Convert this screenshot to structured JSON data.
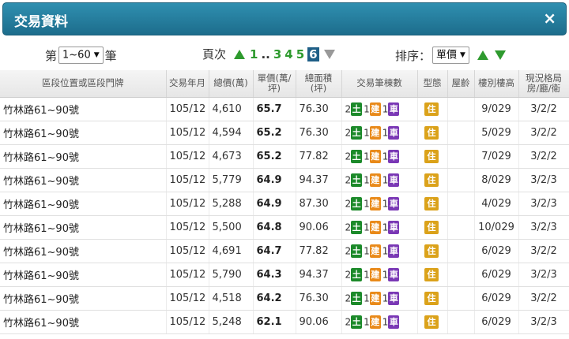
{
  "window": {
    "title": "交易資料",
    "close_glyph": "×"
  },
  "controls": {
    "count_prefix": "第",
    "count_value": "1~60",
    "count_suffix": "筆",
    "pages_label": "頁次",
    "page_first": "1",
    "page_ellipsis": "..",
    "pages": [
      "3",
      "4",
      "5"
    ],
    "page_current": "6",
    "sort_label": "排序：",
    "sort_value": "單價"
  },
  "table": {
    "headers": {
      "location": "區段位置或區段門牌",
      "year_month": "交易年月",
      "total_price": "總價(萬)",
      "unit_price": "單價(萬/坪)",
      "area": "總面積(坪)",
      "units": "交易筆棟數",
      "type": "型態",
      "age": "屋齡",
      "floor": "樓別樓高",
      "layout": "現況格局房/廳/衛"
    },
    "badge_labels": {
      "land": "土",
      "building": "建",
      "parking": "車",
      "type": "住"
    },
    "rows": [
      {
        "location": "竹林路61~90號",
        "ym": "105/12",
        "total": "4,610",
        "unit": "65.7",
        "area": "76.30",
        "land": "2",
        "bldg": "1",
        "park": "1",
        "type": "住",
        "age": "",
        "floor": "9/029",
        "layout": "3/2/2"
      },
      {
        "location": "竹林路61~90號",
        "ym": "105/12",
        "total": "4,594",
        "unit": "65.2",
        "area": "76.30",
        "land": "2",
        "bldg": "1",
        "park": "1",
        "type": "住",
        "age": "",
        "floor": "5/029",
        "layout": "3/2/2"
      },
      {
        "location": "竹林路61~90號",
        "ym": "105/12",
        "total": "4,673",
        "unit": "65.2",
        "area": "77.82",
        "land": "2",
        "bldg": "1",
        "park": "1",
        "type": "住",
        "age": "",
        "floor": "7/029",
        "layout": "3/2/2"
      },
      {
        "location": "竹林路61~90號",
        "ym": "105/12",
        "total": "5,779",
        "unit": "64.9",
        "area": "94.37",
        "land": "2",
        "bldg": "1",
        "park": "1",
        "type": "住",
        "age": "",
        "floor": "8/029",
        "layout": "3/2/3"
      },
      {
        "location": "竹林路61~90號",
        "ym": "105/12",
        "total": "5,288",
        "unit": "64.9",
        "area": "87.30",
        "land": "2",
        "bldg": "1",
        "park": "1",
        "type": "住",
        "age": "",
        "floor": "4/029",
        "layout": "3/2/3"
      },
      {
        "location": "竹林路61~90號",
        "ym": "105/12",
        "total": "5,500",
        "unit": "64.8",
        "area": "90.06",
        "land": "2",
        "bldg": "1",
        "park": "1",
        "type": "住",
        "age": "",
        "floor": "10/029",
        "layout": "3/2/3"
      },
      {
        "location": "竹林路61~90號",
        "ym": "105/12",
        "total": "4,691",
        "unit": "64.7",
        "area": "77.82",
        "land": "2",
        "bldg": "1",
        "park": "1",
        "type": "住",
        "age": "",
        "floor": "6/029",
        "layout": "3/2/2"
      },
      {
        "location": "竹林路61~90號",
        "ym": "105/12",
        "total": "5,790",
        "unit": "64.3",
        "area": "94.37",
        "land": "2",
        "bldg": "1",
        "park": "1",
        "type": "住",
        "age": "",
        "floor": "6/029",
        "layout": "3/2/3"
      },
      {
        "location": "竹林路61~90號",
        "ym": "105/12",
        "total": "4,518",
        "unit": "64.2",
        "area": "76.30",
        "land": "2",
        "bldg": "1",
        "park": "1",
        "type": "住",
        "age": "",
        "floor": "6/029",
        "layout": "3/2/2"
      },
      {
        "location": "竹林路61~90號",
        "ym": "105/12",
        "total": "5,248",
        "unit": "62.1",
        "area": "90.06",
        "land": "2",
        "bldg": "1",
        "park": "1",
        "type": "住",
        "age": "",
        "floor": "6/029",
        "layout": "3/2/3"
      }
    ]
  }
}
